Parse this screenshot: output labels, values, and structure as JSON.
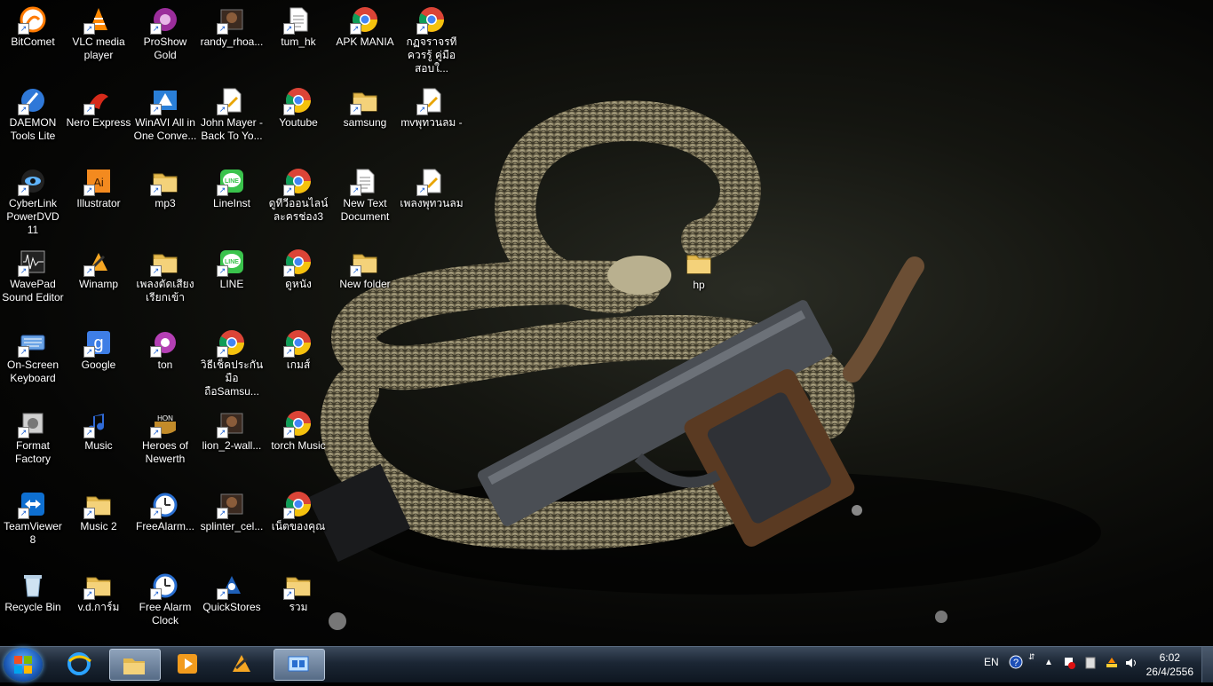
{
  "desktop": {
    "icons": [
      {
        "label": "BitComet",
        "icon": "bitcomet-icon",
        "col": 0,
        "row": 0
      },
      {
        "label": "DAEMON Tools Lite",
        "icon": "daemon-tools-icon",
        "col": 0,
        "row": 1
      },
      {
        "label": "CyberLink PowerDVD 11",
        "icon": "powerdvd-icon",
        "col": 0,
        "row": 2
      },
      {
        "label": "WavePad Sound Editor",
        "icon": "wavepad-icon",
        "col": 0,
        "row": 3
      },
      {
        "label": "On-Screen Keyboard",
        "icon": "keyboard-icon",
        "col": 0,
        "row": 4
      },
      {
        "label": "Format Factory",
        "icon": "format-factory-icon",
        "col": 0,
        "row": 5
      },
      {
        "label": "TeamViewer 8",
        "icon": "teamviewer-icon",
        "col": 0,
        "row": 6
      },
      {
        "label": "Recycle Bin",
        "icon": "recycle-bin-icon",
        "col": 0,
        "row": 7
      },
      {
        "label": "VLC media player",
        "icon": "vlc-icon",
        "col": 1,
        "row": 0
      },
      {
        "label": "Nero Express",
        "icon": "nero-icon",
        "col": 1,
        "row": 1
      },
      {
        "label": "Illustrator",
        "icon": "illustrator-icon",
        "col": 1,
        "row": 2
      },
      {
        "label": "Winamp",
        "icon": "winamp-icon",
        "col": 1,
        "row": 3
      },
      {
        "label": "Google",
        "icon": "google-icon",
        "col": 1,
        "row": 4
      },
      {
        "label": "Music",
        "icon": "music-icon",
        "col": 1,
        "row": 5
      },
      {
        "label": "Music 2",
        "icon": "folder-icon",
        "col": 1,
        "row": 6
      },
      {
        "label": "v.d.การ์ม",
        "icon": "folder-icon",
        "col": 1,
        "row": 7
      },
      {
        "label": "ProShow Gold",
        "icon": "proshow-icon",
        "col": 2,
        "row": 0
      },
      {
        "label": "WinAVI All in One Conve...",
        "icon": "winavi-icon",
        "col": 2,
        "row": 1
      },
      {
        "label": "mp3",
        "icon": "folder-icon",
        "col": 2,
        "row": 2
      },
      {
        "label": "เพลงตัดเสียงเรียกเข้า",
        "icon": "folder-icon",
        "col": 2,
        "row": 3
      },
      {
        "label": "ton",
        "icon": "proshow-file-icon",
        "col": 2,
        "row": 4
      },
      {
        "label": "Heroes of Newerth",
        "icon": "hon-icon",
        "col": 2,
        "row": 5
      },
      {
        "label": "FreeAlarm...",
        "icon": "alarm-clock-icon",
        "col": 2,
        "row": 6
      },
      {
        "label": "Free Alarm Clock",
        "icon": "alarm-clock-icon",
        "col": 2,
        "row": 7
      },
      {
        "label": "randy_rhoa...",
        "icon": "image-file-icon",
        "col": 3,
        "row": 0
      },
      {
        "label": "John Mayer - Back To Yo...",
        "icon": "media-file-icon",
        "col": 3,
        "row": 1
      },
      {
        "label": "LineInst",
        "icon": "line-icon",
        "col": 3,
        "row": 2
      },
      {
        "label": "LINE",
        "icon": "line-icon",
        "col": 3,
        "row": 3
      },
      {
        "label": "วิธีเช็คประกันมือถือSamsu...",
        "icon": "chrome-icon",
        "col": 3,
        "row": 4
      },
      {
        "label": "lion_2-wall...",
        "icon": "image-file-icon",
        "col": 3,
        "row": 5
      },
      {
        "label": "splinter_cel...",
        "icon": "image-file-icon",
        "col": 3,
        "row": 6
      },
      {
        "label": "QuickStores",
        "icon": "quickstores-icon",
        "col": 3,
        "row": 7
      },
      {
        "label": "tum_hk",
        "icon": "text-file-icon",
        "col": 4,
        "row": 0
      },
      {
        "label": "Youtube",
        "icon": "chrome-icon",
        "col": 4,
        "row": 1
      },
      {
        "label": "ดูทีวีออนไลน์ ละครช่อง3",
        "icon": "chrome-icon",
        "col": 4,
        "row": 2
      },
      {
        "label": "ดูหนัง",
        "icon": "chrome-icon",
        "col": 4,
        "row": 3
      },
      {
        "label": "เกมส์",
        "icon": "chrome-icon",
        "col": 4,
        "row": 4
      },
      {
        "label": "torch Music",
        "icon": "chrome-icon",
        "col": 4,
        "row": 5
      },
      {
        "label": "เน็ตของคุณ",
        "icon": "chrome-icon",
        "col": 4,
        "row": 6
      },
      {
        "label": "รวม",
        "icon": "folder-icon",
        "col": 4,
        "row": 7
      },
      {
        "label": "APK MANIA",
        "icon": "chrome-icon",
        "col": 5,
        "row": 0
      },
      {
        "label": "samsung",
        "icon": "folder-icon",
        "col": 5,
        "row": 1
      },
      {
        "label": "New Text Document",
        "icon": "text-file-icon",
        "col": 5,
        "row": 2
      },
      {
        "label": "New folder",
        "icon": "folder-icon",
        "col": 5,
        "row": 3
      },
      {
        "label": "กฏจราจรทีควรรู้ คู่มือสอบใ...",
        "icon": "chrome-icon",
        "col": 6,
        "row": 0
      },
      {
        "label": "mvพุทวนลม -",
        "icon": "media-file-icon",
        "col": 6,
        "row": 1
      },
      {
        "label": "เพลงพุทวนลม",
        "icon": "media-file-icon",
        "col": 6,
        "row": 2
      }
    ],
    "floating_icon": {
      "label": "hp",
      "icon": "folder-icon"
    }
  },
  "taskbar": {
    "start_icon": "windows-start-icon",
    "pinned": [
      {
        "name": "internet-explorer-icon",
        "active": false
      },
      {
        "name": "file-explorer-icon",
        "active": true
      },
      {
        "name": "media-player-icon",
        "active": false
      },
      {
        "name": "winamp-taskbar-icon",
        "active": false
      },
      {
        "name": "remote-desktop-icon",
        "active": true
      }
    ],
    "tray": {
      "language": "EN",
      "time": "6:02",
      "date": "26/4/2556"
    }
  }
}
